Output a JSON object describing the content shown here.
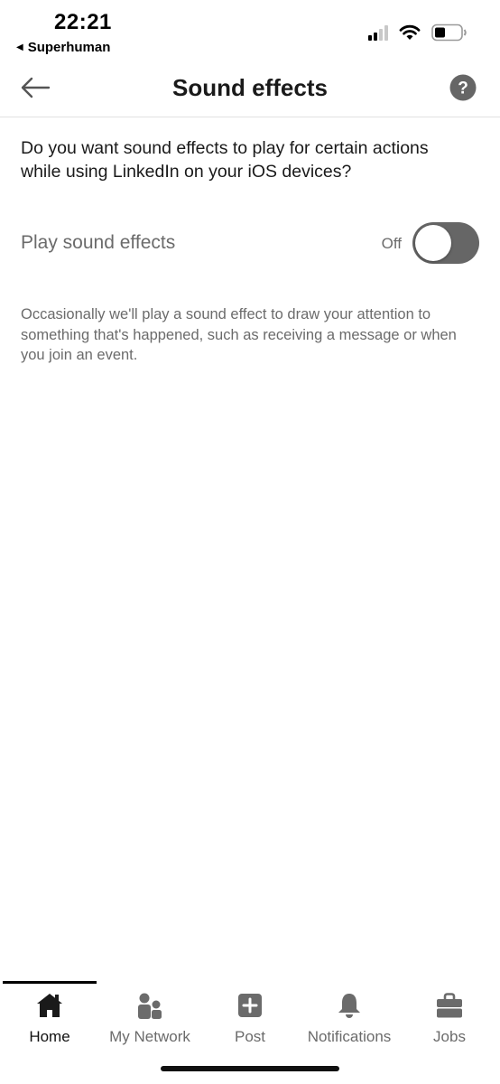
{
  "status_bar": {
    "time": "22:21",
    "back_app": "Superhuman",
    "icons": [
      "signal-icon",
      "wifi-icon",
      "battery-icon"
    ]
  },
  "header": {
    "title": "Sound effects",
    "back_icon": "arrow-left-icon",
    "help_icon": "question-mark-icon"
  },
  "content": {
    "question": "Do you want sound effects to play for certain actions while using LinkedIn on your iOS devices?",
    "setting_label": "Play sound effects",
    "toggle_state": "Off",
    "toggle_on": false,
    "helper_text": "Occasionally we'll play a sound effect to draw your attention to something that's happened, such as receiving a message or when you join an event."
  },
  "bottom_nav": {
    "items": [
      {
        "label": "Home",
        "icon": "home-icon",
        "active": true
      },
      {
        "label": "My Network",
        "icon": "network-icon",
        "active": false
      },
      {
        "label": "Post",
        "icon": "plus-square-icon",
        "active": false
      },
      {
        "label": "Notifications",
        "icon": "bell-icon",
        "active": false
      },
      {
        "label": "Jobs",
        "icon": "briefcase-icon",
        "active": false
      }
    ]
  },
  "colors": {
    "text_primary": "#1a1a1a",
    "text_secondary": "#6b6b6b",
    "toggle_off": "#666666",
    "icon_active": "#1a1a1a",
    "icon_inactive": "#6b6b6b"
  }
}
